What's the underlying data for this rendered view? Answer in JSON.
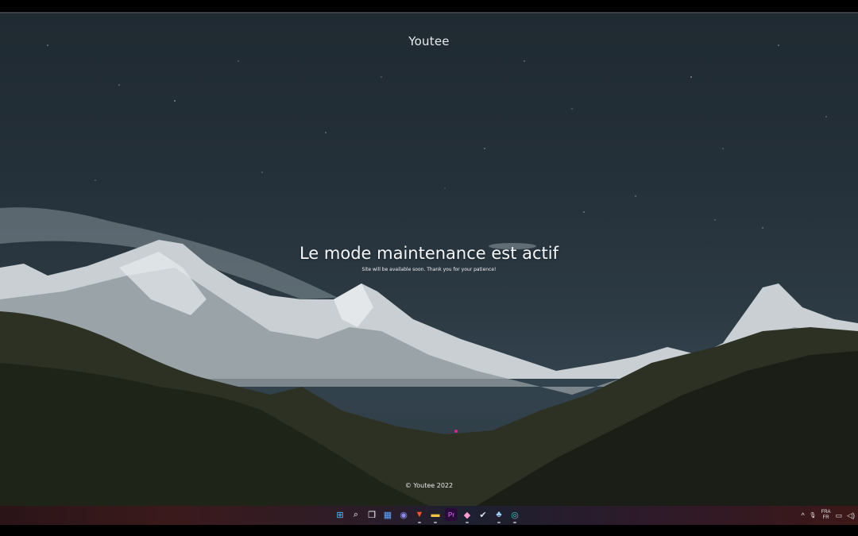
{
  "site": {
    "brand": "Youtee",
    "headline": "Le mode maintenance est actif",
    "subline": "Site will be available soon. Thank you for your patience!",
    "footer": "© Youtee 2022"
  },
  "taskbar": {
    "icons": [
      {
        "name": "start-icon",
        "glyph": "⊞"
      },
      {
        "name": "search-icon",
        "glyph": "⌕"
      },
      {
        "name": "task-view-icon",
        "glyph": "❐"
      },
      {
        "name": "widgets-icon",
        "glyph": "▦"
      },
      {
        "name": "teams-chat-icon",
        "glyph": "◉"
      },
      {
        "name": "brave-browser-icon",
        "glyph": "▼"
      },
      {
        "name": "file-explorer-icon",
        "glyph": "▬"
      },
      {
        "name": "premiere-pro-icon",
        "glyph": "Pr"
      },
      {
        "name": "photos-icon",
        "glyph": "◆"
      },
      {
        "name": "steam-icon",
        "glyph": "✔"
      },
      {
        "name": "app-icon",
        "glyph": "♣"
      },
      {
        "name": "edge-browser-icon",
        "glyph": "◎"
      }
    ],
    "tray": {
      "chevron": "^",
      "mic": "🎙",
      "lang_top": "FRA",
      "lang_bottom": "FR",
      "display": "▭",
      "volume": "◁)"
    }
  },
  "colors": {
    "sky": "#25313a",
    "text": "#f4f6f8",
    "taskbar_accent": "#3b1a1c"
  }
}
